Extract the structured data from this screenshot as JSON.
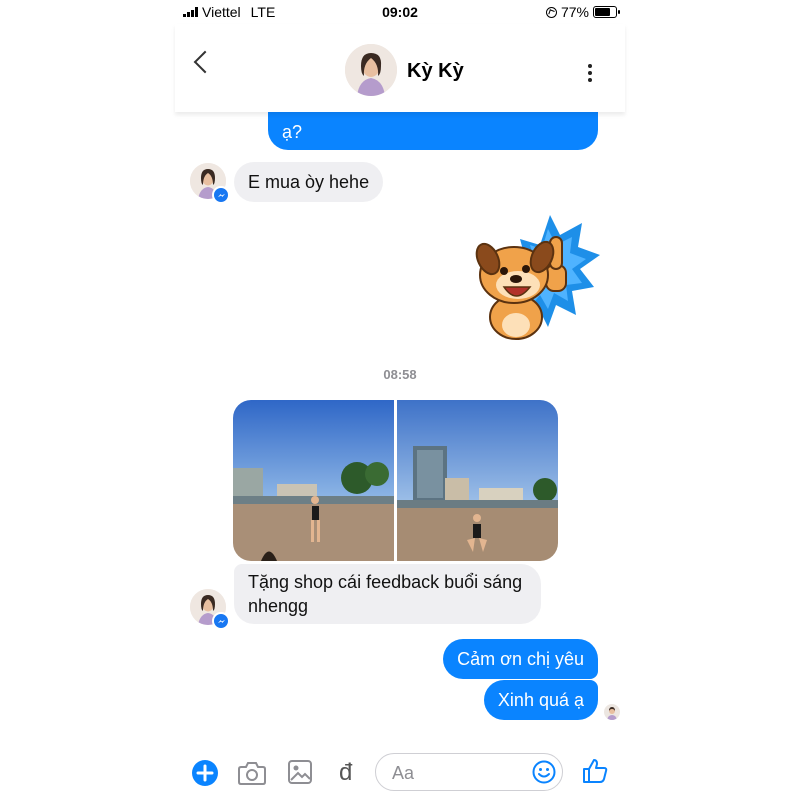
{
  "status_bar": {
    "carrier": "Viettel",
    "network": "LTE",
    "time": "09:02",
    "battery": "77%",
    "battery_level": 0.77
  },
  "header": {
    "contact_name": "Kỳ Kỳ"
  },
  "messages": {
    "partial_sent": "ạ?",
    "received_1": "E mua òy hehe",
    "timestamp": "08:58",
    "received_2": "Tặng shop cái feedback buổi sáng nhengg",
    "sent_1": "Cảm ơn chị yêu",
    "sent_2": "Xinh quá ạ"
  },
  "composer": {
    "placeholder": "Aa",
    "currency_symbol": "đ"
  },
  "colors": {
    "accent": "#0a84ff",
    "brand": "#1877f2",
    "bubble_theirs": "#efeff2"
  },
  "icons": [
    "back-chevron-icon",
    "more-vertical-icon",
    "messenger-badge-icon",
    "plus-circle-icon",
    "camera-icon",
    "image-icon",
    "dong-currency-icon",
    "emoji-icon",
    "thumbs-up-icon"
  ]
}
